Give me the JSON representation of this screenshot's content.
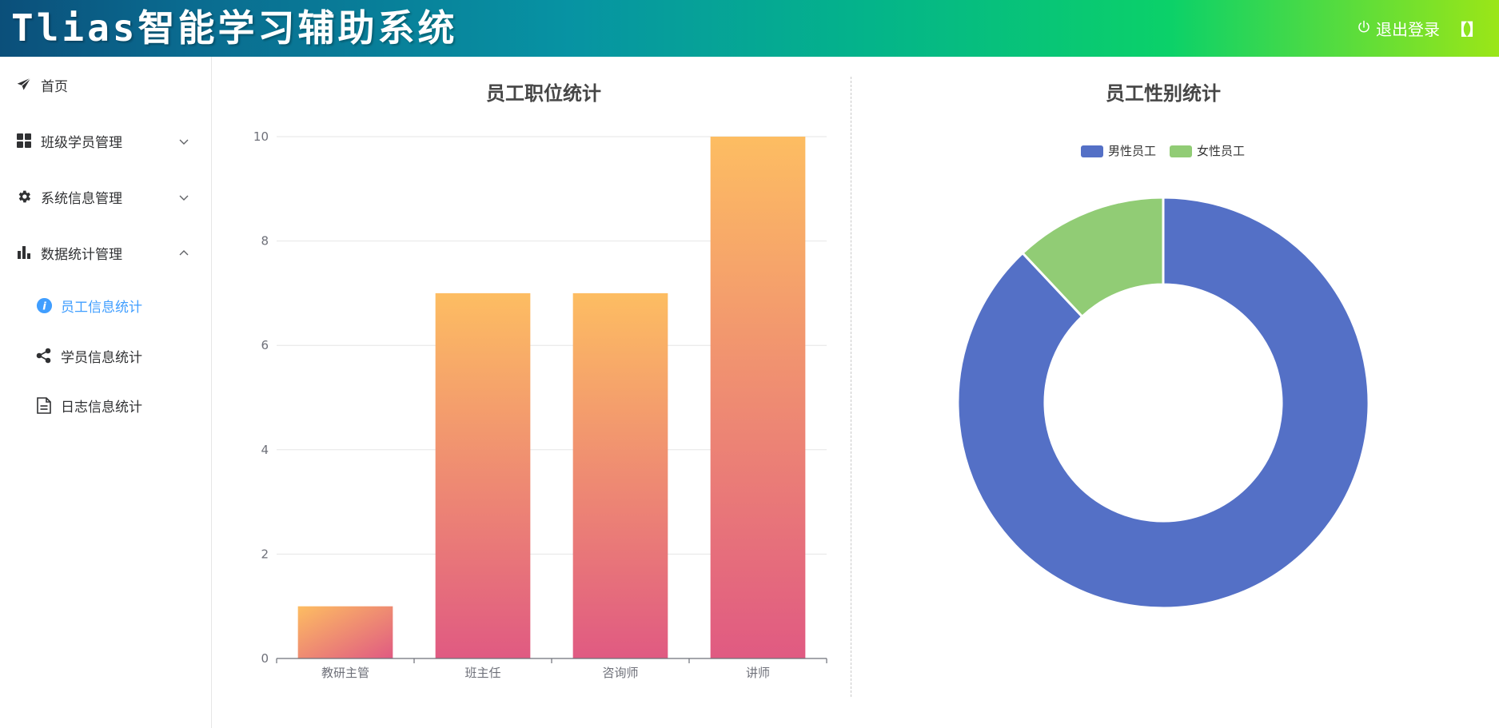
{
  "header": {
    "app_title": "Tlias智能学习辅助系统",
    "logout_label": "退出登录",
    "bracket_label": "【】"
  },
  "sidebar": {
    "items": [
      {
        "label": "首页",
        "icon": "paper-plane-icon"
      },
      {
        "label": "班级学员管理",
        "icon": "grid-icon",
        "expanded": false
      },
      {
        "label": "系统信息管理",
        "icon": "gear-icon",
        "expanded": false
      },
      {
        "label": "数据统计管理",
        "icon": "bar-chart-icon",
        "expanded": true
      }
    ],
    "sub_items": [
      {
        "label": "员工信息统计",
        "icon": "info-icon",
        "active": true
      },
      {
        "label": "学员信息统计",
        "icon": "share-icon",
        "active": false
      },
      {
        "label": "日志信息统计",
        "icon": "document-icon",
        "active": false
      }
    ]
  },
  "colors": {
    "accent": "#409eff",
    "bar_top": "#fdbd62",
    "bar_bottom": "#e05a82",
    "male": "#5470c6",
    "female": "#91cc75"
  },
  "chart_data": [
    {
      "type": "bar",
      "title": "员工职位统计",
      "categories": [
        "教研主管",
        "班主任",
        "咨询师",
        "讲师"
      ],
      "values": [
        1,
        7,
        7,
        10
      ],
      "ylim": [
        0,
        10
      ],
      "yticks": [
        "0",
        "2",
        "4",
        "6",
        "8",
        "10"
      ],
      "grid": true
    },
    {
      "type": "pie",
      "title": "员工性别统计",
      "legend_position": "top-center",
      "series": [
        {
          "name": "男性员工",
          "value": 22
        },
        {
          "name": "女性员工",
          "value": 3
        }
      ]
    }
  ]
}
